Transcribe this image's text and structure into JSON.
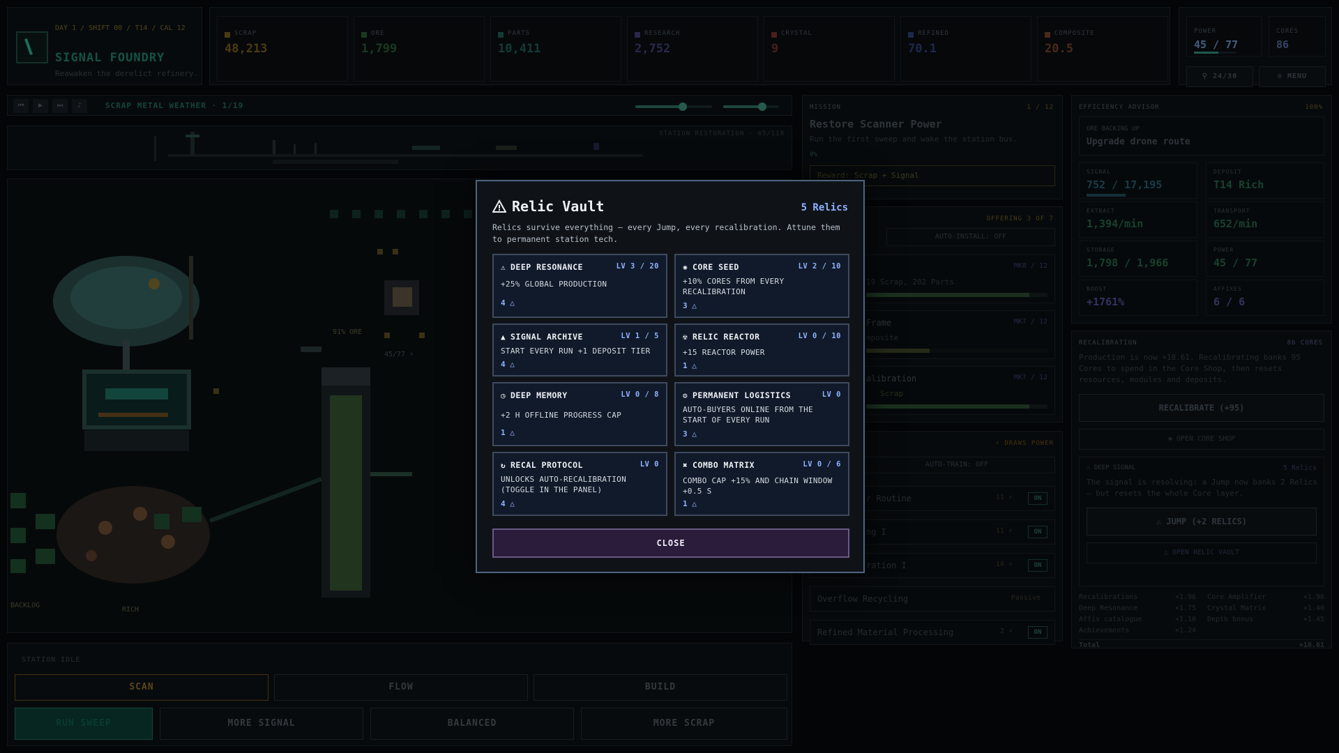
{
  "header": {
    "day_line": "DAY 1 / SHIFT 00 / T14 / CAL 12",
    "game_title": "SIGNAL FOUNDRY",
    "tagline": "Reawaken the derelict refinery."
  },
  "resources": [
    {
      "label": "SCRAP",
      "value": "48,213",
      "color": "#c99a2e"
    },
    {
      "label": "ORE",
      "value": "1,799",
      "color": "#3f9a52"
    },
    {
      "label": "PARTS",
      "value": "10,411",
      "color": "#2f9a8a"
    },
    {
      "label": "RESEARCH",
      "value": "2,752",
      "color": "#6a6ac8"
    },
    {
      "label": "CRYSTAL",
      "value": "9",
      "color": "#c84a4a"
    },
    {
      "label": "REFINED",
      "value": "70.1",
      "color": "#4a6ac8"
    },
    {
      "label": "COMPOSITE",
      "value": "20.5",
      "color": "#c86a3a"
    }
  ],
  "power": {
    "power_label": "POWER",
    "power_value": "45 / 77",
    "power_fill": 0.58,
    "cores_label": "CORES",
    "cores_value": "86",
    "drones_btn": "24/30",
    "menu_btn": "MENU"
  },
  "player": {
    "track": "SCRAP METAL WEATHER · 1/19",
    "volume_music": 0.62,
    "volume_sfx": 0.7
  },
  "restoration": {
    "label": "STATION RESTORATION · 65/118"
  },
  "world": {
    "ore_label": "91% ORE",
    "power_label": "45/77 ⚡",
    "backlog_label": "BACKLOG",
    "rich_label": "RICH"
  },
  "controls": {
    "status": "STATION IDLE",
    "tabs": [
      "SCAN",
      "FLOW",
      "BUILD"
    ],
    "run": "RUN SWEEP",
    "modes": [
      "MORE SIGNAL",
      "BALANCED",
      "MORE SCRAP"
    ]
  },
  "mission": {
    "label": "MISSION",
    "step": "1 / 12",
    "title": "Restore Scanner Power",
    "desc": "Run the first sweep and wake the station bus.",
    "progress": "0%",
    "reward": "Reward: Scrap + Signal"
  },
  "offering": {
    "label": "OFFERING 3 OF 7",
    "auto_install": "AUTO-INSTALL: OFF",
    "items": [
      {
        "name": "d",
        "level": "MK8 / 12",
        "sub": "19 Scrap, 202 Parts",
        "fill": 0.9
      },
      {
        "name": "Frame",
        "level": "MK7 / 12",
        "sub": "mposite",
        "fill": 0.35
      },
      {
        "name": "alibration",
        "level": "MK7 / 12",
        "sub": "Scrap",
        "fill": 0.9
      }
    ]
  },
  "training": {
    "draws": "DRAWS POWER",
    "auto_train": "AUTO-TRAIN: OFF",
    "rows": [
      {
        "name": "r Routine",
        "cost": "11 ⚡",
        "state": "ON"
      },
      {
        "name": "ng I",
        "cost": "11 ⚡",
        "state": "ON"
      },
      {
        "name": "ration I",
        "cost": "14 ⚡",
        "state": "ON"
      },
      {
        "name": "Overflow Recycling",
        "cost": "Passive",
        "state": ""
      },
      {
        "name": "Refined Material Processing",
        "cost": "2 ⚡",
        "state": "ON"
      }
    ]
  },
  "advisor": {
    "label": "EFFICIENCY ADVISOR",
    "pct": "100%",
    "tip_label": "ORE BACKING UP",
    "tip": "Upgrade drone route",
    "stats": [
      {
        "label": "SIGNAL",
        "value": "752 / 17,195",
        "color": "#2f7f9a"
      },
      {
        "label": "DEPOSIT",
        "value": "T14 Rich",
        "color": "#2f8a5a"
      },
      {
        "label": "EXTRACT",
        "value": "1,394/min",
        "color": "#2f8a5a"
      },
      {
        "label": "TRANSPORT",
        "value": "652/min",
        "color": "#2f8a5a"
      },
      {
        "label": "STORAGE",
        "value": "1,798 / 1,966",
        "color": "#2f8a5a"
      },
      {
        "label": "POWER",
        "value": "45 / 77",
        "color": "#2f8a5a"
      },
      {
        "label": "BOOST",
        "value": "+1761%",
        "color": "#6a6ac8"
      },
      {
        "label": "AFFIXES",
        "value": "6 / 6",
        "color": "#6a6ac8"
      }
    ]
  },
  "recal": {
    "label": "RECALIBRATION",
    "cores": "86 CORES",
    "desc": "Production is now ×18.61. Recalibrating banks 95 Cores to spend in the Core Shop, then resets resources, modules and deposits.",
    "button": "RECALIBRATE (+95)",
    "shop": "OPEN CORE SHOP",
    "deep_label": "DEEP SIGNAL",
    "deep_relics": "5 Relics",
    "deep_desc": "The signal is resolving: a Jump now banks 2 Relics — but resets the whole Core layer.",
    "jump": "JUMP (+2 RELICS)",
    "vault": "OPEN RELIC VAULT",
    "mult_left": [
      [
        "Recalibrations",
        "×1.96"
      ],
      [
        "Deep Resonance",
        "×1.75"
      ],
      [
        "Affix catalogue",
        "×1.10"
      ],
      [
        "Achievements",
        "×1.24"
      ]
    ],
    "mult_right": [
      [
        "Core Amplifier",
        "×1.96"
      ],
      [
        "Crystal Matrix",
        "×1.40"
      ],
      [
        "Depth bonus",
        "×1.45"
      ]
    ],
    "total_label": "Total",
    "total": "×18.61"
  },
  "modal": {
    "title": "Relic Vault",
    "count": "5 Relics",
    "desc": "Relics survive everything — every Jump, every recalibration. Attune them to permanent station tech.",
    "close": "CLOSE",
    "relics": [
      {
        "icon": "⚠",
        "name": "DEEP RESONANCE",
        "level": "LV 3 / 20",
        "effect": "+25% GLOBAL PRODUCTION",
        "cost": "4 △"
      },
      {
        "icon": "✺",
        "name": "CORE SEED",
        "level": "LV 2 / 10",
        "effect": "+10% CORES FROM EVERY RECALIBRATION",
        "cost": "3 △"
      },
      {
        "icon": "▲",
        "name": "SIGNAL ARCHIVE",
        "level": "LV 1 / 5",
        "effect": "START EVERY RUN +1 DEPOSIT TIER",
        "cost": "4 △"
      },
      {
        "icon": "☢",
        "name": "RELIC REACTOR",
        "level": "LV 0 / 10",
        "effect": "+15 REACTOR POWER",
        "cost": "1 △"
      },
      {
        "icon": "◷",
        "name": "DEEP MEMORY",
        "level": "LV 0 / 8",
        "effect": "+2 H OFFLINE PROGRESS CAP",
        "cost": "1 △"
      },
      {
        "icon": "⚙",
        "name": "PERMANENT LOGISTICS",
        "level": "LV 0",
        "effect": "AUTO-BUYERS ONLINE FROM THE START OF EVERY RUN",
        "cost": "3 △"
      },
      {
        "icon": "↻",
        "name": "RECAL PROTOCOL",
        "level": "LV 0",
        "effect": "UNLOCKS AUTO-RECALIBRATION (TOGGLE IN THE PANEL)",
        "cost": "4 △"
      },
      {
        "icon": "✖",
        "name": "COMBO MATRIX",
        "level": "LV 0 / 6",
        "effect": "COMBO CAP +15% AND CHAIN WINDOW +0.5 S",
        "cost": "1 △"
      }
    ]
  }
}
